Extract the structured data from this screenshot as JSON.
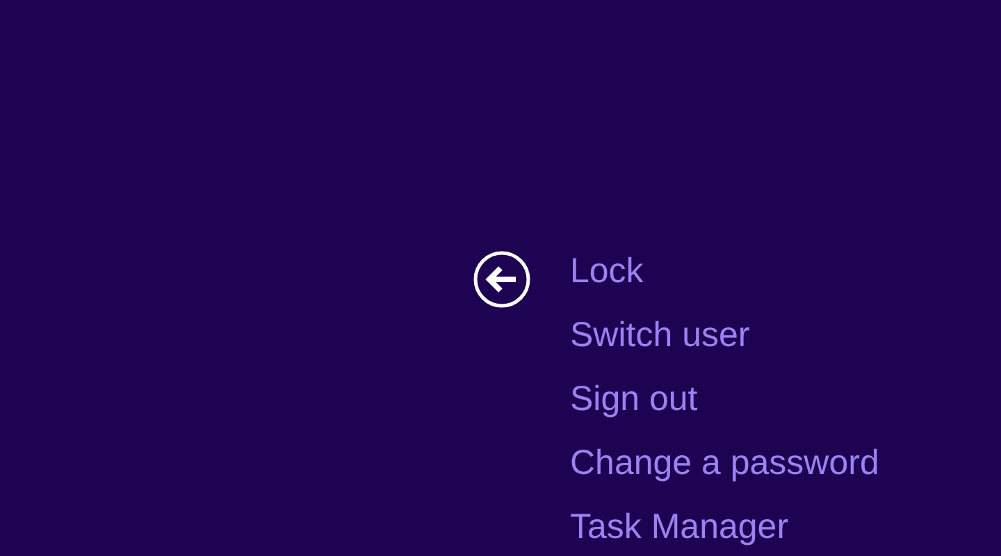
{
  "menu": {
    "items": [
      {
        "label": "Lock"
      },
      {
        "label": "Switch user"
      },
      {
        "label": "Sign out"
      },
      {
        "label": "Change a password"
      },
      {
        "label": "Task Manager"
      }
    ]
  }
}
